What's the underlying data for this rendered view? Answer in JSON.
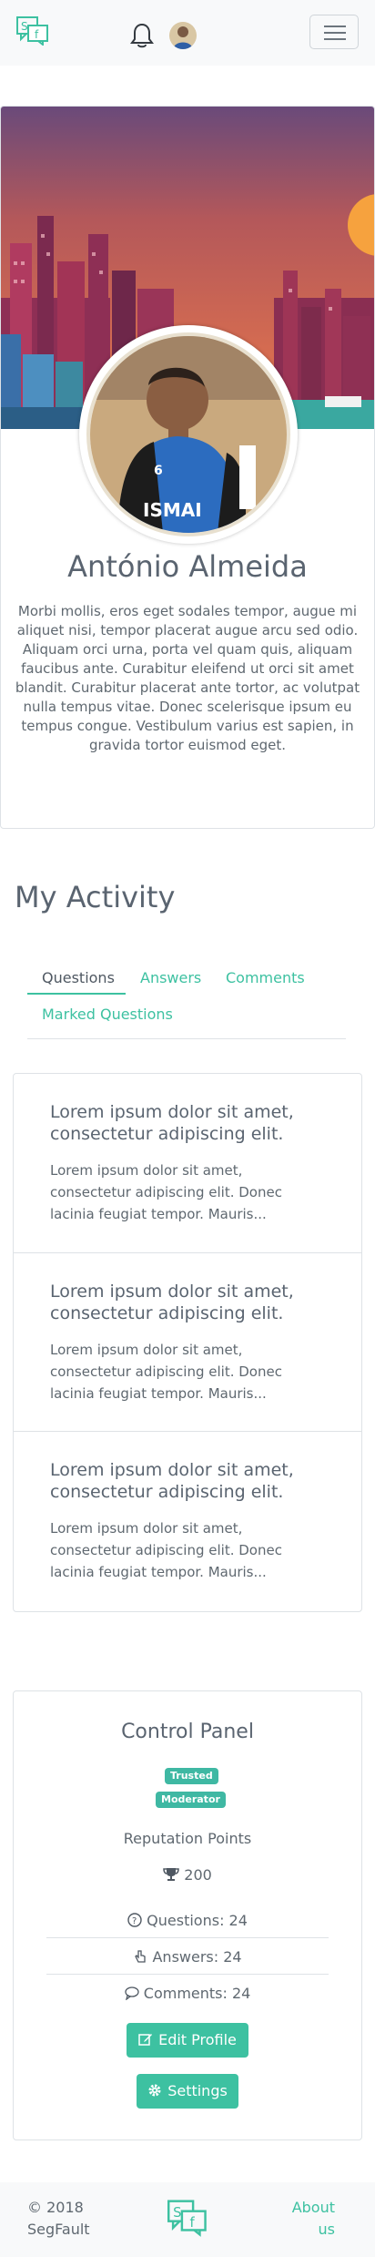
{
  "navbar": {
    "logo_text": "SF",
    "icons": {
      "notifications": "bell-icon",
      "avatar": "user-avatar",
      "menu": "hamburger-menu-icon"
    }
  },
  "profile": {
    "name": "António Almeida",
    "bio": "Morbi mollis, eros eget sodales tempor, augue mi aliquet nisi, tempor placerat augue arcu sed odio. Aliquam orci urna, porta vel quam quis, aliquam faucibus ante. Curabitur eleifend ut orci sit amet blandit. Curabitur placerat ante tortor, ac volutpat nulla tempus vitae. Donec scelerisque ipsum eu tempus congue. Vestibulum varius est sapien, in gravida tortor euismod eget."
  },
  "activity": {
    "heading": "My Activity",
    "tabs": [
      {
        "label": "Questions"
      },
      {
        "label": "Answers"
      },
      {
        "label": "Comments"
      },
      {
        "label": "Marked Questions"
      }
    ],
    "questions": [
      {
        "title": "Lorem ipsum dolor sit amet, consectetur adipiscing elit.",
        "body": "Lorem ipsum dolor sit amet, consectetur adipiscing elit. Donec lacinia feugiat tempor. Mauris..."
      },
      {
        "title": "Lorem ipsum dolor sit amet, consectetur adipiscing elit.",
        "body": "Lorem ipsum dolor sit amet, consectetur adipiscing elit. Donec lacinia feugiat tempor. Mauris..."
      },
      {
        "title": "Lorem ipsum dolor sit amet, consectetur adipiscing elit.",
        "body": "Lorem ipsum dolor sit amet, consectetur adipiscing elit. Donec lacinia feugiat tempor. Mauris..."
      }
    ]
  },
  "control_panel": {
    "title": "Control Panel",
    "badges": [
      "Trusted",
      "Moderator"
    ],
    "reputation_label": "Reputation Points",
    "reputation_value": "200",
    "questions_stat": "Questions: 24",
    "answers_stat": "Answers: 24",
    "comments_stat": "Comments: 24",
    "edit_profile_label": "Edit Profile",
    "settings_label": "Settings"
  },
  "footer": {
    "copyright_line1": "© 2018",
    "copyright_line2": "SegFault",
    "about_line1": "About",
    "about_line2": "us",
    "logo_text": "SF"
  },
  "colors": {
    "accent": "#3dc1a1",
    "badge": "#3fb8a3",
    "navbar_bg": "#f8f9fa"
  }
}
